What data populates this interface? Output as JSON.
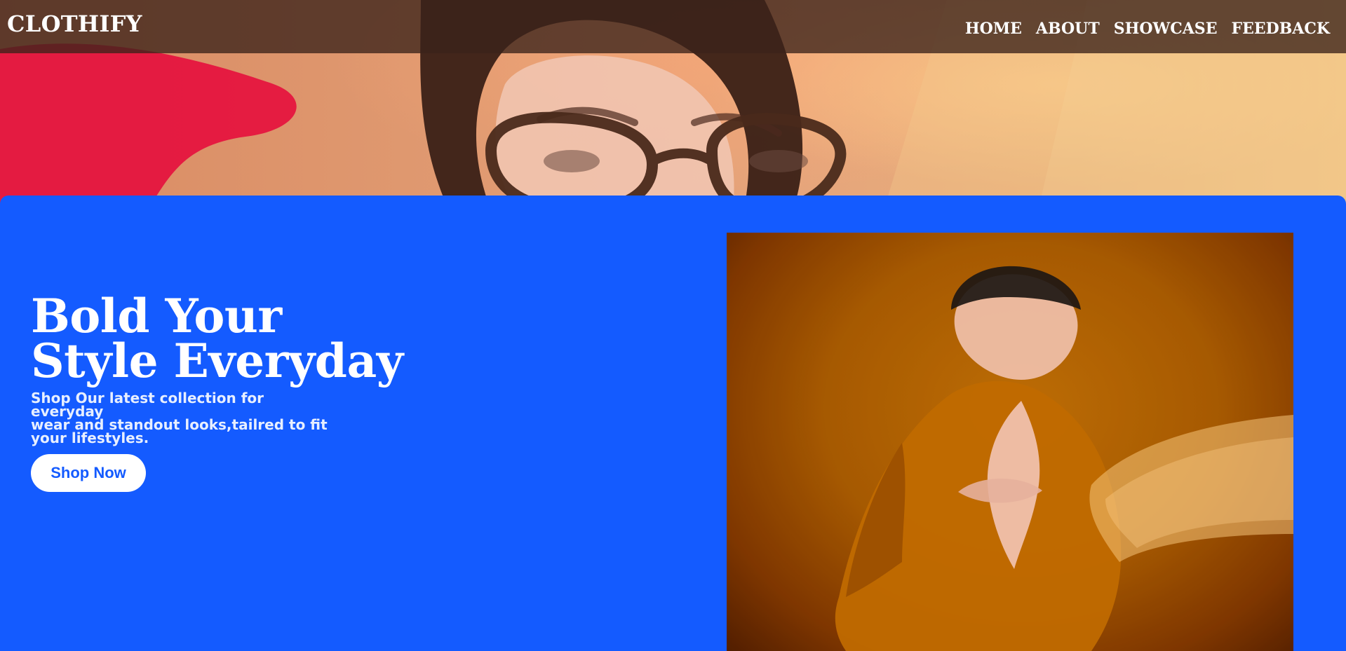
{
  "brand": {
    "name": "CLOTHIFY"
  },
  "nav": {
    "items": [
      {
        "label": "HOME"
      },
      {
        "label": "ABOUT"
      },
      {
        "label": "SHOWCASE"
      },
      {
        "label": "FEEDBACK"
      }
    ]
  },
  "hero": {
    "headline_line1": "Bold Your",
    "headline_line2": "Style Everyday",
    "subtext_line1": "Shop Our latest collection for everyday",
    "subtext_line2": "wear and standout looks,tailred to fit",
    "subtext_line3": "your lifestyles.",
    "cta_label": "Shop Now"
  },
  "colors": {
    "panel_blue": "#145bff",
    "cta_text_blue": "#145bff",
    "nav_overlay": "#3b221a"
  }
}
